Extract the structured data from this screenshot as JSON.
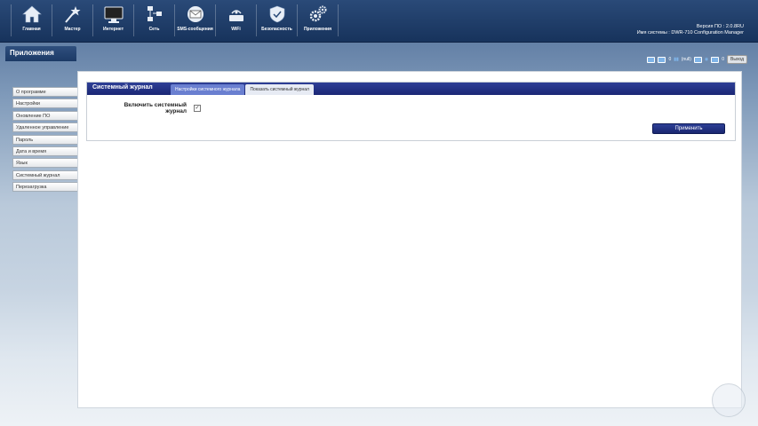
{
  "nav": [
    {
      "label": "Главная",
      "icon": "home-icon"
    },
    {
      "label": "Мастер",
      "icon": "wizard-icon"
    },
    {
      "label": "Интернет",
      "icon": "monitor-icon"
    },
    {
      "label": "Сеть",
      "icon": "network-icon"
    },
    {
      "label": "SMS-сообщения",
      "icon": "mail-icon"
    },
    {
      "label": "WiFi",
      "icon": "wifi-icon"
    },
    {
      "label": "Безопасность",
      "icon": "shield-icon"
    },
    {
      "label": "Приложения",
      "icon": "gears-icon"
    }
  ],
  "system": {
    "firmware_label": "Версия ПО",
    "firmware_value": "2.0.8RU",
    "name_label": "Имя системы",
    "name_value": "DWR-710 Configuration Manager"
  },
  "status": {
    "sms_count": "0",
    "signal_text": "(null)",
    "mail_count": "0",
    "logout_label": "Выход"
  },
  "app_title": "Приложения",
  "sidebar": {
    "items": [
      {
        "label": "О программе"
      },
      {
        "label": "Настройки"
      },
      {
        "label": "Оновление ПО"
      },
      {
        "label": "Удаленное управление"
      },
      {
        "label": "Пароль"
      },
      {
        "label": "Дата и время"
      },
      {
        "label": "Язык"
      },
      {
        "label": "Системный журнал"
      },
      {
        "label": "Перезагрузка"
      }
    ]
  },
  "panel": {
    "title": "Системный журнал",
    "tabs": [
      {
        "label": "Настройки системного журнала",
        "active": true
      },
      {
        "label": "Показать системный журнал",
        "active": false
      }
    ],
    "enable_label": "Включить системный журнал",
    "enable_checked": true,
    "apply_label": "Применить"
  },
  "colors": {
    "header_bg": "#17335c",
    "section_header": "#1b2775",
    "active_tab": "#6a7fd0"
  }
}
